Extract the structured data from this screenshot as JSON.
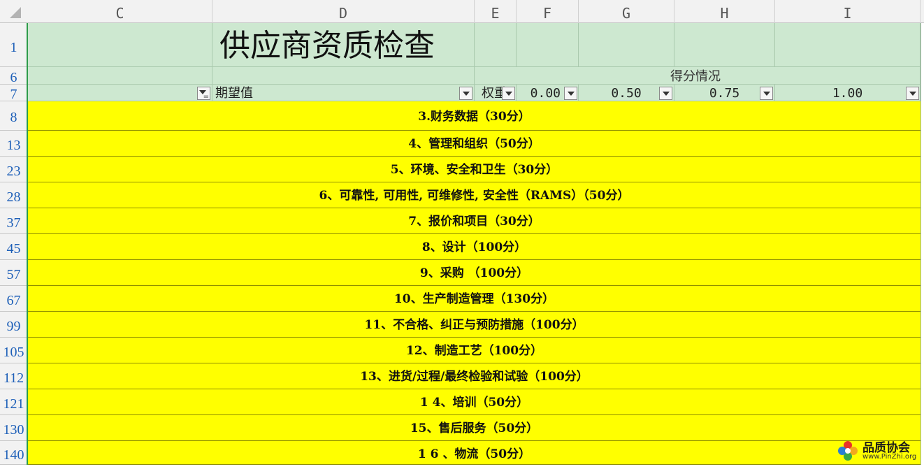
{
  "columns": {
    "c": "C",
    "d": "D",
    "e": "E",
    "f": "F",
    "g": "G",
    "h": "H",
    "i": "I"
  },
  "rows": {
    "r1": "1",
    "r6": "6",
    "r7": "7",
    "r8": "8",
    "r13": "13",
    "r23": "23",
    "r28": "28",
    "r37": "37",
    "r45": "45",
    "r57": "57",
    "r67": "67",
    "r99": "99",
    "r105": "105",
    "r112": "112",
    "r121": "121",
    "r130": "130",
    "r140": "140"
  },
  "sheet": {
    "title": "供应商资质检查",
    "score_group": "得分情况",
    "expected_value": "期望值",
    "weight": "权重",
    "score_0": "0.00",
    "score_050": "0.50",
    "score_075": "0.75",
    "score_100": "1.00"
  },
  "sections": [
    "3.财务数据（30分）",
    "4、管理和组织（50分）",
    "5、环境、安全和卫生（30分）",
    "6、可靠性, 可用性, 可维修性, 安全性（RAMS）（50分）",
    "7、报价和项目（30分）",
    "8、设计（100分）",
    "9、采购 （100分）",
    "10、生产制造管理（130分）",
    "11、不合格、纠正与预防措施（100分）",
    "12、制造工艺（100分）",
    "13、进货/过程/最终检验和试验（100分）",
    "1 4、培训（50分）",
    "15、售后服务（50分）",
    "1 6 、物流（50分）"
  ],
  "watermark": {
    "name": "品质协会",
    "url": "www.PinZhi.org"
  },
  "colors": {
    "header_green": "#cde8d0",
    "section_yellow": "#ffff00",
    "row_number_blue": "#1d5fb8"
  }
}
